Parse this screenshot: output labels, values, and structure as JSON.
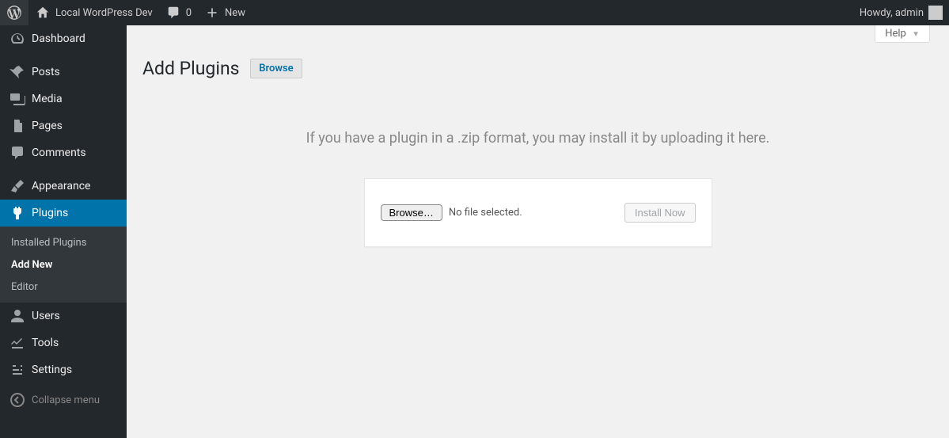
{
  "adminbar": {
    "site_title": "Local WordPress Dev",
    "comment_count": "0",
    "new_label": "New",
    "howdy": "Howdy, admin"
  },
  "menu": {
    "dashboard": "Dashboard",
    "posts": "Posts",
    "media": "Media",
    "pages": "Pages",
    "comments": "Comments",
    "appearance": "Appearance",
    "plugins": "Plugins",
    "users": "Users",
    "tools": "Tools",
    "settings": "Settings",
    "collapse": "Collapse menu"
  },
  "submenu": {
    "installed": "Installed Plugins",
    "add_new": "Add New",
    "editor": "Editor"
  },
  "screen_meta": {
    "help": "Help"
  },
  "page": {
    "title": "Add Plugins",
    "action_browse": "Browse",
    "instructions": "If you have a plugin in a .zip format, you may install it by uploading it here.",
    "browse_button": "Browse…",
    "file_status": "No file selected.",
    "install_button": "Install Now"
  }
}
